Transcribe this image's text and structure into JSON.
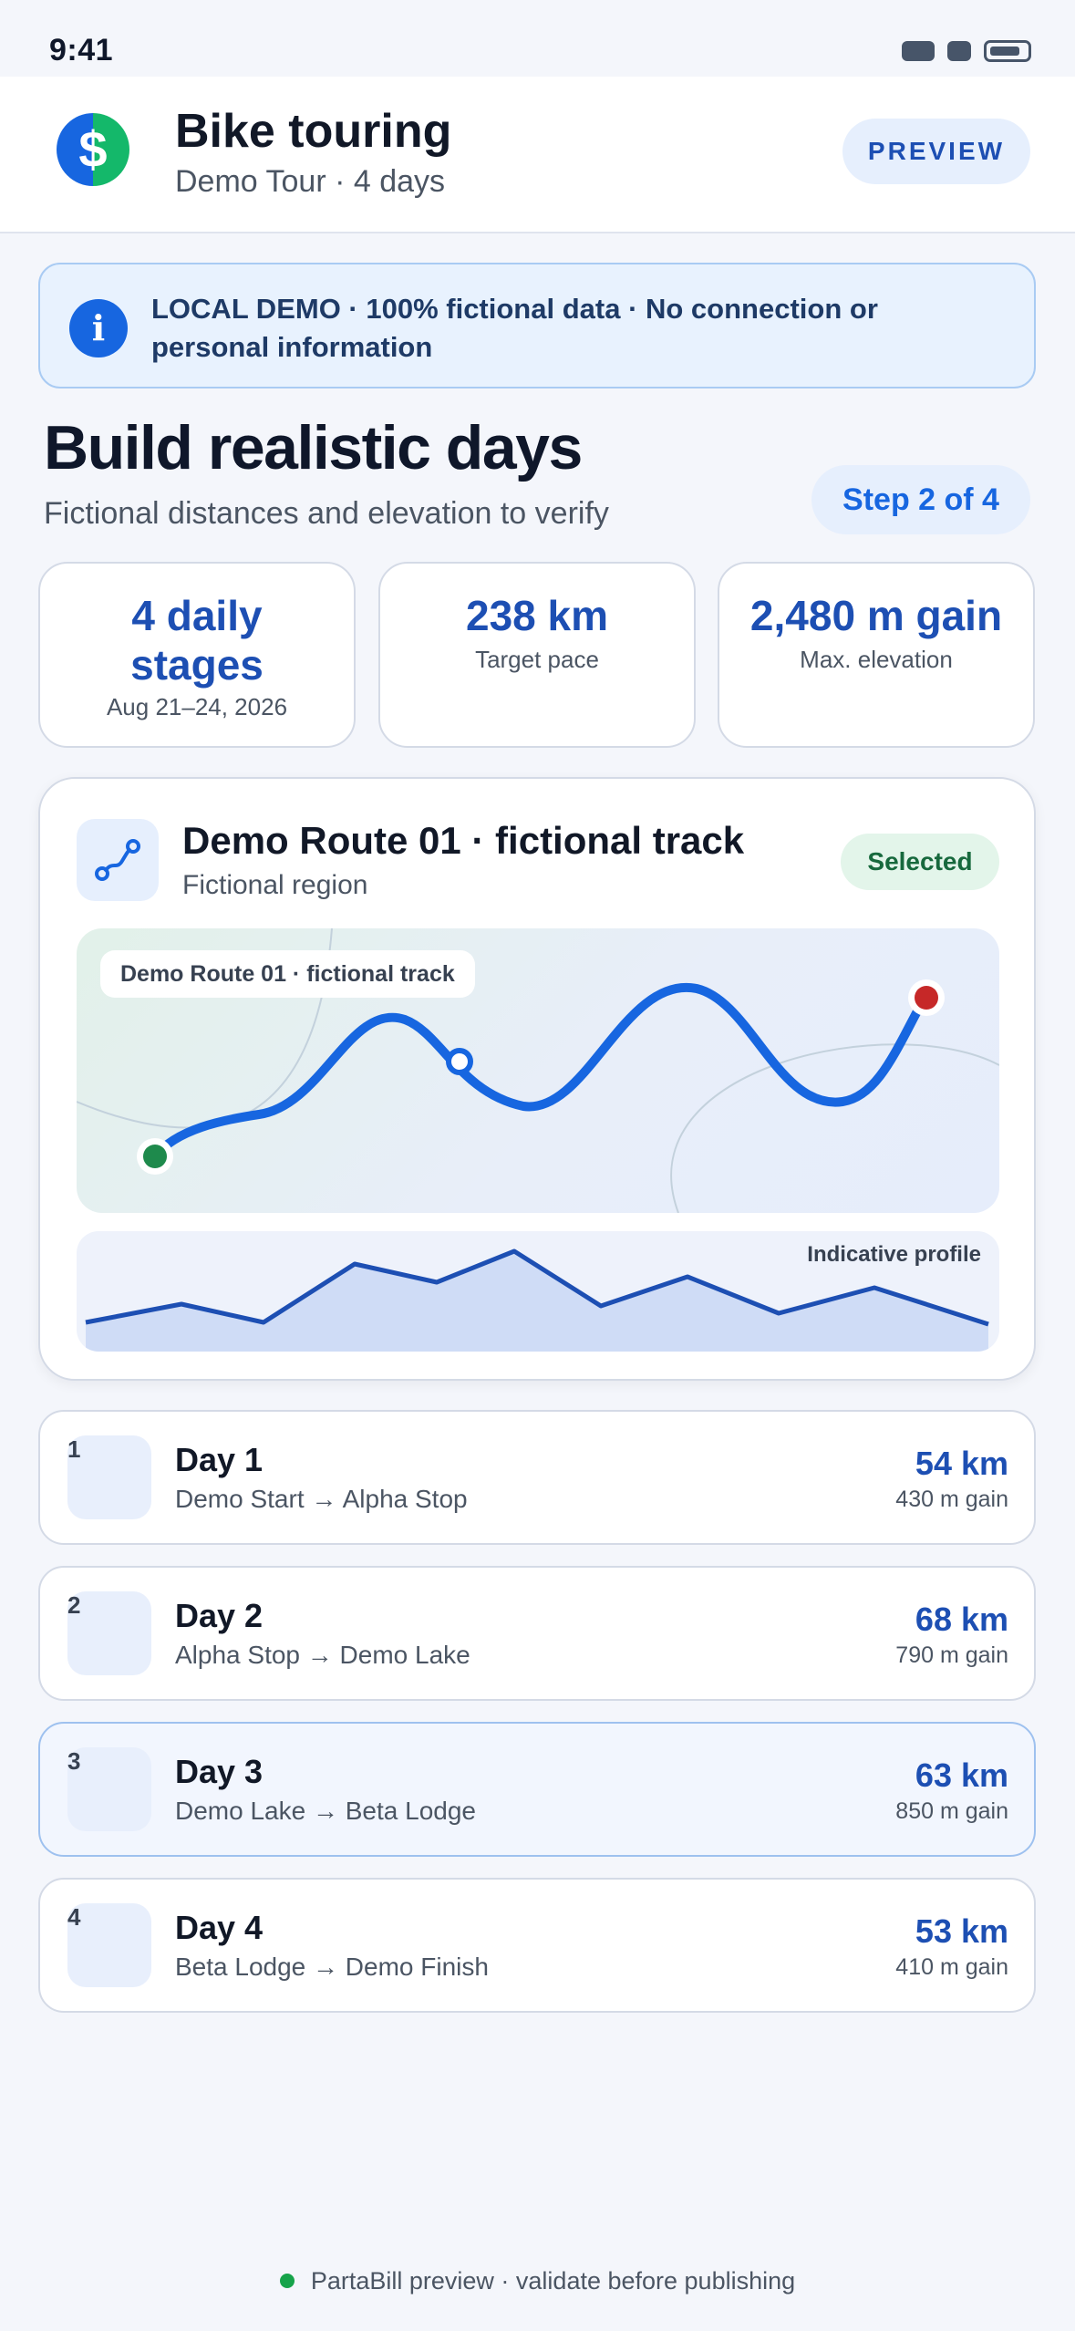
{
  "status_bar": {
    "time": "9:41"
  },
  "header": {
    "logo_glyph": "$",
    "title": "Bike touring",
    "subtitle": "Demo Tour · 4 days",
    "preview_label": "PREVIEW"
  },
  "notice": {
    "icon": "info-icon",
    "text": "LOCAL DEMO · 100% fictional data · No connection or personal information"
  },
  "page": {
    "title": "Build realistic days",
    "subtitle": "Fictional distances and elevation to verify",
    "step": "Step 2 of 4"
  },
  "stats": [
    {
      "value": "4 daily stages",
      "label": "Aug 21–24, 2026"
    },
    {
      "value": "238 km",
      "label": "Target pace"
    },
    {
      "value": "2,480 m gain",
      "label": "Max. elevation"
    }
  ],
  "route": {
    "title": "Demo Route 01 · fictional track",
    "region": "Fictional region",
    "status": "Selected",
    "map_label": "Demo Route 01 · fictional track",
    "profile_label": "Indicative profile"
  },
  "days": [
    {
      "num": "1",
      "title": "Day 1",
      "route": "Demo Start → Alpha Stop",
      "km": "54 km",
      "gain": "430 m gain"
    },
    {
      "num": "2",
      "title": "Day 2",
      "route": "Alpha Stop → Demo Lake",
      "km": "68 km",
      "gain": "790 m gain"
    },
    {
      "num": "3",
      "title": "Day 3",
      "route": "Demo Lake → Beta Lodge",
      "km": "63 km",
      "gain": "850 m gain"
    },
    {
      "num": "4",
      "title": "Day 4",
      "route": "Beta Lodge → Demo Finish",
      "km": "53 km",
      "gain": "410 m gain"
    }
  ],
  "footer": {
    "text": "PartaBill preview · validate before publishing"
  },
  "colors": {
    "accent": "#1766e0",
    "accent_dark": "#1d4fb3",
    "success": "#17693d",
    "start_marker": "#1e8a4c",
    "end_marker": "#c62828"
  }
}
